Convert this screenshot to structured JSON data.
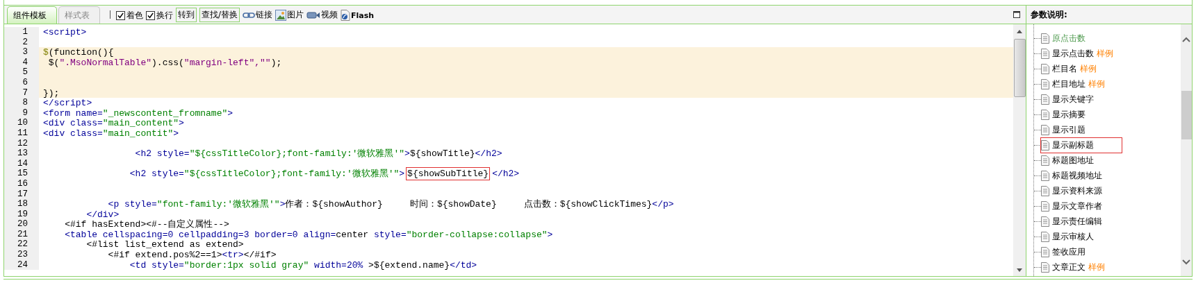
{
  "tabs": [
    {
      "label": "组件模板",
      "selected": true
    },
    {
      "label": "样式表",
      "selected": false
    }
  ],
  "toolbar": {
    "checkboxes": [
      {
        "label": "着色",
        "checked": true
      },
      {
        "label": "换行",
        "checked": true
      }
    ],
    "buttons": [
      "转到",
      "查找/替换"
    ],
    "inserts": [
      {
        "kind": "link",
        "label": "链接"
      },
      {
        "kind": "image",
        "label": "图片"
      },
      {
        "kind": "video",
        "label": "视频"
      },
      {
        "kind": "flash",
        "label": "Flash"
      }
    ]
  },
  "editor": {
    "lines": [
      {
        "number": "1",
        "highlighted": false,
        "segments": [
          {
            "t": "<script>",
            "kind": "tag"
          }
        ]
      },
      {
        "number": "2",
        "highlighted": false
      },
      {
        "number": "3",
        "highlighted": true,
        "segments": [
          {
            "t": "$",
            "kind": "dollar"
          },
          {
            "t": "(function(){",
            "kind": "text"
          }
        ]
      },
      {
        "number": "4",
        "highlighted": true,
        "segments": [
          {
            "t": " $(",
            "kind": "text"
          },
          {
            "t": "\".MsoNormalTable\"",
            "kind": "string"
          },
          {
            "t": ").css(",
            "kind": "text"
          },
          {
            "t": "\"margin-left\",\"\"",
            "kind": "string"
          },
          {
            "t": ");",
            "kind": "text"
          }
        ]
      },
      {
        "number": "5",
        "highlighted": true
      },
      {
        "number": "6",
        "highlighted": true
      },
      {
        "number": "7",
        "highlighted": true,
        "segments": [
          {
            "t": "});",
            "kind": "text"
          }
        ]
      },
      {
        "number": "8",
        "highlighted": false,
        "segments": [
          {
            "t": "</script>",
            "kind": "tag"
          }
        ]
      },
      {
        "number": "9",
        "highlighted": false,
        "segments": [
          {
            "t": "<form name=",
            "kind": "tag"
          },
          {
            "t": "\"_newscontent_fromname\"",
            "kind": "value"
          },
          {
            "t": ">",
            "kind": "tag"
          }
        ]
      },
      {
        "number": "10",
        "highlighted": false,
        "segments": [
          {
            "t": "<div class=",
            "kind": "tag"
          },
          {
            "t": "\"main_content\"",
            "kind": "value"
          },
          {
            "t": ">",
            "kind": "tag"
          }
        ]
      },
      {
        "number": "11",
        "highlighted": false,
        "segments": [
          {
            "t": "<div class=",
            "kind": "tag"
          },
          {
            "t": "\"main_contit\"",
            "kind": "value"
          },
          {
            "t": ">",
            "kind": "tag"
          }
        ]
      },
      {
        "number": "12",
        "highlighted": false
      },
      {
        "number": "13",
        "highlighted": false,
        "segments": [
          {
            "t": "                 <h2 style=",
            "kind": "tag"
          },
          {
            "t": "\"${cssTitleColor};font-family:'微软雅黑'\"",
            "kind": "value"
          },
          {
            "t": ">",
            "kind": "tag"
          },
          {
            "t": "${showTitle}",
            "kind": "text"
          },
          {
            "t": "</h2>",
            "kind": "tag"
          }
        ]
      },
      {
        "number": "14",
        "highlighted": false
      },
      {
        "number": "15",
        "highlighted": false,
        "segments": [
          {
            "t": "                <h2 style=",
            "kind": "tag"
          },
          {
            "t": "\"${cssTitleColor};font-family:'微软雅黑'\"",
            "kind": "value"
          },
          {
            "t": ">",
            "kind": "tag"
          },
          {
            "t": "${showSubTitle}",
            "kind": "boxed"
          },
          {
            "t": "</h2>",
            "kind": "tag"
          }
        ]
      },
      {
        "number": "16",
        "highlighted": false
      },
      {
        "number": "17",
        "highlighted": false
      },
      {
        "number": "18",
        "highlighted": false,
        "segments": [
          {
            "t": "            <p style=",
            "kind": "tag"
          },
          {
            "t": "\"font-family:'微软雅黑'\"",
            "kind": "value"
          },
          {
            "t": ">",
            "kind": "tag"
          },
          {
            "t": "作者：${showAuthor}     时间：${showDate}     点击数：${showClickTimes}",
            "kind": "text"
          },
          {
            "t": "</p>",
            "kind": "tag"
          }
        ]
      },
      {
        "number": "19",
        "highlighted": false,
        "segments": [
          {
            "t": "        </div>",
            "kind": "tag"
          }
        ]
      },
      {
        "number": "20",
        "highlighted": false,
        "segments": [
          {
            "t": "    <#if hasExtend><#--自定义属性-->",
            "kind": "text"
          }
        ]
      },
      {
        "number": "21",
        "highlighted": false,
        "segments": [
          {
            "t": "    <table cellspacing=0 cellpadding=3 border=0 align=",
            "kind": "tag"
          },
          {
            "t": "center ",
            "kind": "text"
          },
          {
            "t": "style=",
            "kind": "tag"
          },
          {
            "t": "\"border-collapse:collapse\"",
            "kind": "value"
          },
          {
            "t": ">",
            "kind": "tag"
          }
        ]
      },
      {
        "number": "22",
        "highlighted": false,
        "segments": [
          {
            "t": "        <#list list_extend as extend>",
            "kind": "text"
          }
        ]
      },
      {
        "number": "23",
        "highlighted": false,
        "segments": [
          {
            "t": "            <#if extend.pos%2==1>",
            "kind": "text"
          },
          {
            "t": "<tr>",
            "kind": "tag"
          },
          {
            "t": "</#if>",
            "kind": "text"
          }
        ]
      },
      {
        "number": "24",
        "highlighted": false,
        "segments": [
          {
            "t": "                <td style=",
            "kind": "tag"
          },
          {
            "t": "\"border:1px solid gray\"",
            "kind": "value"
          },
          {
            "t": " width=20% ",
            "kind": "tag"
          },
          {
            "t": ">${extend.name}",
            "kind": "text"
          },
          {
            "t": "</td>",
            "kind": "tag"
          }
        ]
      }
    ]
  },
  "params": {
    "title": "参数说明:",
    "items": [
      {
        "name": "原点击数",
        "kind": "builtin",
        "highlighted": false
      },
      {
        "name": "显示点击数",
        "kind": "param",
        "example": "样例",
        "highlighted": false
      },
      {
        "name": "栏目名",
        "kind": "param",
        "example": "样例",
        "highlighted": false
      },
      {
        "name": "栏目地址",
        "kind": "param",
        "example": "样例",
        "highlighted": false
      },
      {
        "name": "显示关键字",
        "kind": "param",
        "highlighted": false
      },
      {
        "name": "显示摘要",
        "kind": "param",
        "highlighted": false
      },
      {
        "name": "显示引题",
        "kind": "param",
        "highlighted": false
      },
      {
        "name": "显示副标题",
        "kind": "param",
        "highlighted": true
      },
      {
        "name": "标题图地址",
        "kind": "param",
        "highlighted": false
      },
      {
        "name": "标题视频地址",
        "kind": "param",
        "highlighted": false
      },
      {
        "name": "显示资料来源",
        "kind": "param",
        "highlighted": false
      },
      {
        "name": "显示文章作者",
        "kind": "param",
        "highlighted": false
      },
      {
        "name": "显示责任编辑",
        "kind": "param",
        "highlighted": false
      },
      {
        "name": "显示审核人",
        "kind": "param",
        "highlighted": false
      },
      {
        "name": "签收应用",
        "kind": "param",
        "highlighted": false
      },
      {
        "name": "文章正文",
        "kind": "param",
        "example": "样例",
        "highlighted": false
      }
    ]
  }
}
